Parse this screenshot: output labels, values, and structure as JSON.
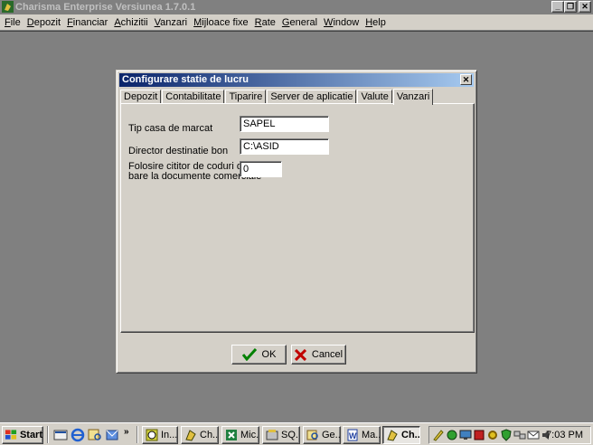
{
  "window": {
    "title": "Charisma Enterprise Versiunea 1.7.0.1",
    "controls": {
      "minimize": "_",
      "restore": "❐",
      "close": "✕"
    }
  },
  "menu": [
    {
      "label": "File",
      "mnemonic": "F",
      "rest": "ile"
    },
    {
      "label": "Depozit",
      "mnemonic": "D",
      "rest": "epozit"
    },
    {
      "label": "Financiar",
      "mnemonic": "F",
      "rest": "inanciar"
    },
    {
      "label": "Achizitii",
      "mnemonic": "A",
      "rest": "chizitii"
    },
    {
      "label": "Vanzari",
      "mnemonic": "V",
      "rest": "anzari"
    },
    {
      "label": "Mijloace fixe",
      "mnemonic": "M",
      "rest": "ijloace fixe"
    },
    {
      "label": "Rate",
      "mnemonic": "R",
      "rest": "ate"
    },
    {
      "label": "General",
      "mnemonic": "G",
      "rest": "eneral"
    },
    {
      "label": "Window",
      "mnemonic": "W",
      "rest": "indow"
    },
    {
      "label": "Help",
      "mnemonic": "H",
      "rest": "elp"
    }
  ],
  "dialog": {
    "title": "Configurare statie de lucru",
    "close": "✕",
    "tabs": [
      "Depozit",
      "Contabilitate",
      "Tiparire",
      "Server de aplicatie",
      "Valute",
      "Vanzari"
    ],
    "active_tab": "Vanzari",
    "fields": {
      "tip_casa": {
        "label": "Tip casa de marcat",
        "value": "SAPEL"
      },
      "director_bon": {
        "label": "Director destinatie bon",
        "value": "C:\\ASID"
      },
      "cititor_coduri": {
        "label_line1": "Folosire cititor de coduri de",
        "label_line2": "bare la documente comerciale",
        "value": "0"
      }
    },
    "buttons": {
      "ok": "OK",
      "cancel": "Cancel"
    },
    "colors": {
      "ok_icon": "#008000",
      "cancel_icon": "#c00000"
    }
  },
  "taskbar": {
    "start_label": "Start",
    "quicklaunch_more": "»",
    "tasks": [
      {
        "label": "In...",
        "active": false
      },
      {
        "label": "Ch...",
        "active": false
      },
      {
        "label": "Mic...",
        "active": false
      },
      {
        "label": "SQ...",
        "active": false
      },
      {
        "label": "Ge...",
        "active": false
      },
      {
        "label": "Ma...",
        "active": false
      },
      {
        "label": "Ch...",
        "active": true
      }
    ],
    "clock": "7:03 PM"
  }
}
